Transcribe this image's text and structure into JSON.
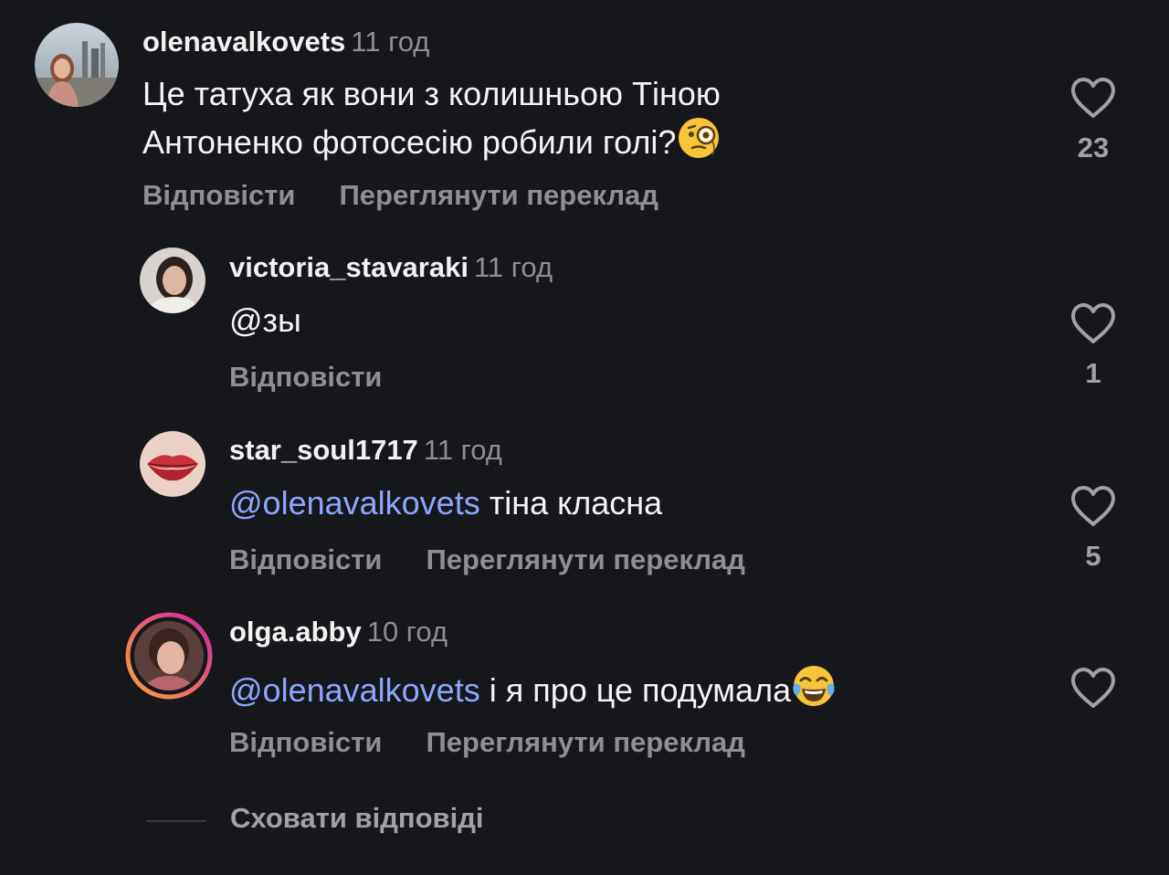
{
  "comments": [
    {
      "username": "olenavalkovets",
      "time": "11 год",
      "text_line1": "Це татуха як вони з колишньою Тіною",
      "text_line2": "Антоненко фотосесію робили голі?",
      "emoji": "face-with-monocle",
      "reply_label": "Відповісти",
      "translate_label": "Переглянути переклад",
      "likes": "23"
    },
    {
      "username": "victoria_stavaraki",
      "time": "11 год",
      "text": "@зы",
      "reply_label": "Відповісти",
      "likes": "1"
    },
    {
      "username": "star_soul1717",
      "time": "11 год",
      "mention": "@olenavalkovets",
      "text": " тіна класна",
      "reply_label": "Відповісти",
      "translate_label": "Переглянути переклад",
      "likes": "5"
    },
    {
      "username": "olga.abby",
      "time": "10 год",
      "mention": "@olenavalkovets",
      "text": " і я про це подумала",
      "emoji": "face-with-tears-of-joy",
      "reply_label": "Відповісти",
      "translate_label": "Переглянути переклад",
      "likes": ""
    }
  ],
  "hide_replies_label": "Сховати відповіді",
  "colors": {
    "background": "#16171b",
    "mention": "#8fa6ff",
    "secondary_text": "#8e8f94",
    "story_ring_start": "#f7a53a",
    "story_ring_end": "#d6249f"
  }
}
